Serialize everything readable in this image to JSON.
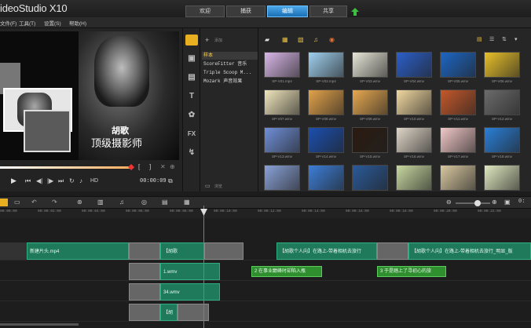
{
  "app": {
    "title": "ideoStudio X10",
    "tabs": [
      {
        "label": "欢迎"
      },
      {
        "label": "捕获"
      },
      {
        "label": "编辑"
      },
      {
        "label": "共享"
      }
    ],
    "active_tab_color": "#2a8ad8"
  },
  "menu": {
    "items": [
      {
        "label": "文件(F)"
      },
      {
        "label": "工具(T)"
      },
      {
        "label": "设置(S)"
      },
      {
        "label": "帮助(H)"
      }
    ]
  },
  "preview": {
    "overlay_text_line1": "胡歌",
    "overlay_text_line2": "顶级摄影师",
    "timecode": "00:00:09",
    "hd_label": "HD"
  },
  "library": {
    "add_label": "添加",
    "items": [
      {
        "label": "样本"
      },
      {
        "label": "ScoreFitter 音乐"
      },
      {
        "label": "Triple Scoop M..."
      },
      {
        "label": "Mozark 声音效果"
      }
    ],
    "browse_label": "浏览"
  },
  "side_tools": {
    "icons": [
      "media-icon",
      "instant-project-icon",
      "transition-icon",
      "title-icon",
      "graphics-icon",
      "fx-icon",
      "path-icon"
    ],
    "title_glyph": "T",
    "fx_glyph": "FX"
  },
  "thumbnails": [
    {
      "label": "SP-V01.mp4",
      "color": "#d9b7e8"
    },
    {
      "label": "SP-V02.mp4",
      "color": "#9fd0ef"
    },
    {
      "label": "SP-V03.wmv",
      "color": "#e8e6d8"
    },
    {
      "label": "SP-V04.wmv",
      "color": "#2b5fc9"
    },
    {
      "label": "SP-V05.wmv",
      "color": "#1d66c4"
    },
    {
      "label": "SP-V06.wmv",
      "color": "#e8c02a"
    },
    {
      "label": "SP-V07.wmv",
      "color": "#f0e6bc"
    },
    {
      "label": "SP-V08.wmv",
      "color": "#e3a24a"
    },
    {
      "label": "SP-V09.wmv",
      "color": "#e7a850"
    },
    {
      "label": "SP-V10.wmv",
      "color": "#f1d8a0"
    },
    {
      "label": "SP-V11.wmv",
      "color": "#c4582a"
    },
    {
      "label": "SP-V12.wmv",
      "color": "#6b6b6b"
    },
    {
      "label": "SP-V13.wmv",
      "color": "#6f8fd8"
    },
    {
      "label": "SP-V14.wmv",
      "color": "#1b4fb0"
    },
    {
      "label": "SP-V15.wmv",
      "color": "#2a1a10"
    },
    {
      "label": "SP-V16.wmv",
      "color": "#e0d6c8"
    },
    {
      "label": "SP-V17.wmv",
      "color": "#f2c8c8"
    },
    {
      "label": "SP-V18.wmv",
      "color": "#2a7fd8"
    },
    {
      "label": "SP-V19.wmv",
      "color": "#8aa2d8"
    },
    {
      "label": "SP-V20.wmv",
      "color": "#3c7ed8"
    },
    {
      "label": "SP-V21.wmv",
      "color": "#2a5a9a"
    },
    {
      "label": "",
      "color": "#c8d8a0"
    },
    {
      "label": "",
      "color": "#d8c8a0"
    },
    {
      "label": "",
      "color": "#e0e8c0"
    },
    {
      "label": "",
      "color": "#3a74c8"
    },
    {
      "label": "",
      "color": "#5a9ae0"
    },
    {
      "label": "",
      "color": "#c8c8d8"
    },
    {
      "label": "",
      "color": "#3a7ae0"
    }
  ],
  "ruler": {
    "labels": [
      "00:00:00:00",
      "00:00:02:00",
      "00:00:04:00",
      "00:00:06:00",
      "00:00:08:00",
      "00:00:10:00",
      "00:00:12:00",
      "00:00:14:00",
      "00:00:16:00",
      "00:00:18:00",
      "00:00:20:00",
      "00:00:22:00"
    ]
  },
  "timeline": {
    "video_clips": [
      {
        "label": "新建片头.mp4"
      },
      {
        "label": "【胡歌"
      },
      {
        "label": "【胡歌个人向】在路上-带着相机去旅行"
      },
      {
        "label": "【胡歌个人向】在路上-带着相机去旅行_明显_版"
      }
    ],
    "overlay1_clip": "1.wmv",
    "overlay1_titles": [
      {
        "label": "2 在事业巅峰时却陷入瓶"
      },
      {
        "label": "3 于是踏上了寻初心的旅"
      }
    ],
    "overlay2_clip": "34.wmv",
    "overlay3_clip": "【胡"
  }
}
